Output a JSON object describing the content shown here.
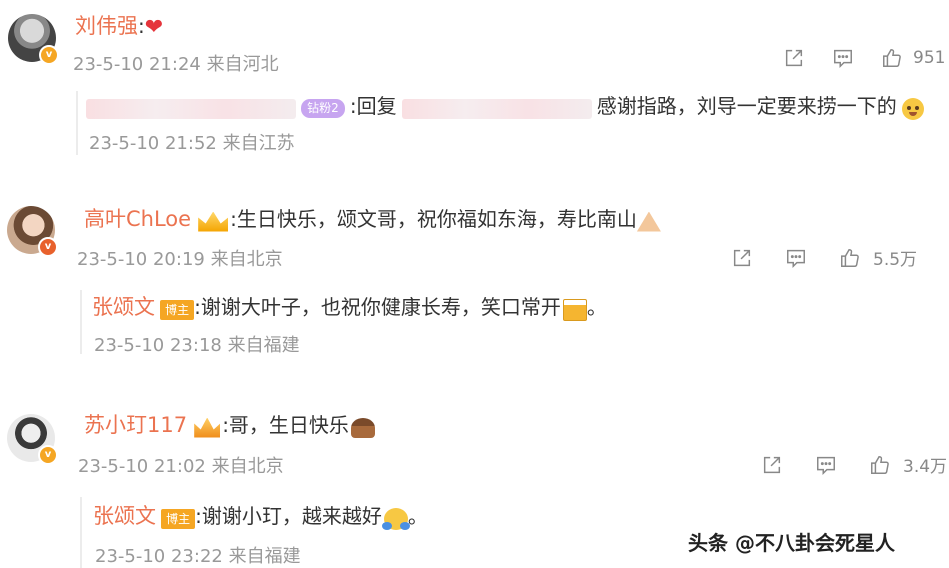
{
  "comments": [
    {
      "name": "刘伟强",
      "text": ":",
      "time": "23-5-10 21:24 来自河北",
      "likes": "951",
      "reply": {
        "prefix": ":回复",
        "text": "感谢指路，刘导一定要来捞一下的",
        "time": "23-5-10 21:52 来自江苏",
        "fan_badge": "钻粉2"
      }
    },
    {
      "name": "高叶ChLoe",
      "text": ":生日快乐，颂文哥，祝你福如东海，寿比南山",
      "time": "23-5-10 20:19 来自北京",
      "likes": "5.5万",
      "reply": {
        "name": "张颂文",
        "tag": "博主",
        "text": ":谢谢大叶子，也祝你健康长寿，笑口常开",
        "end": "。",
        "time": "23-5-10 23:18 来自福建"
      }
    },
    {
      "name": "苏小玎117",
      "text": ":哥，生日快乐",
      "time": "23-5-10 21:02 来自北京",
      "likes": "3.4万",
      "reply": {
        "name": "张颂文",
        "tag": "博主",
        "text": ":谢谢小玎，越来越好",
        "end": "。",
        "time": "23-5-10 23:22 来自福建"
      }
    }
  ],
  "watermark": "头条 @不八卦会死星人",
  "colors": {
    "name": "#eb7350",
    "meta": "#999999",
    "accent": "#f5a623"
  }
}
